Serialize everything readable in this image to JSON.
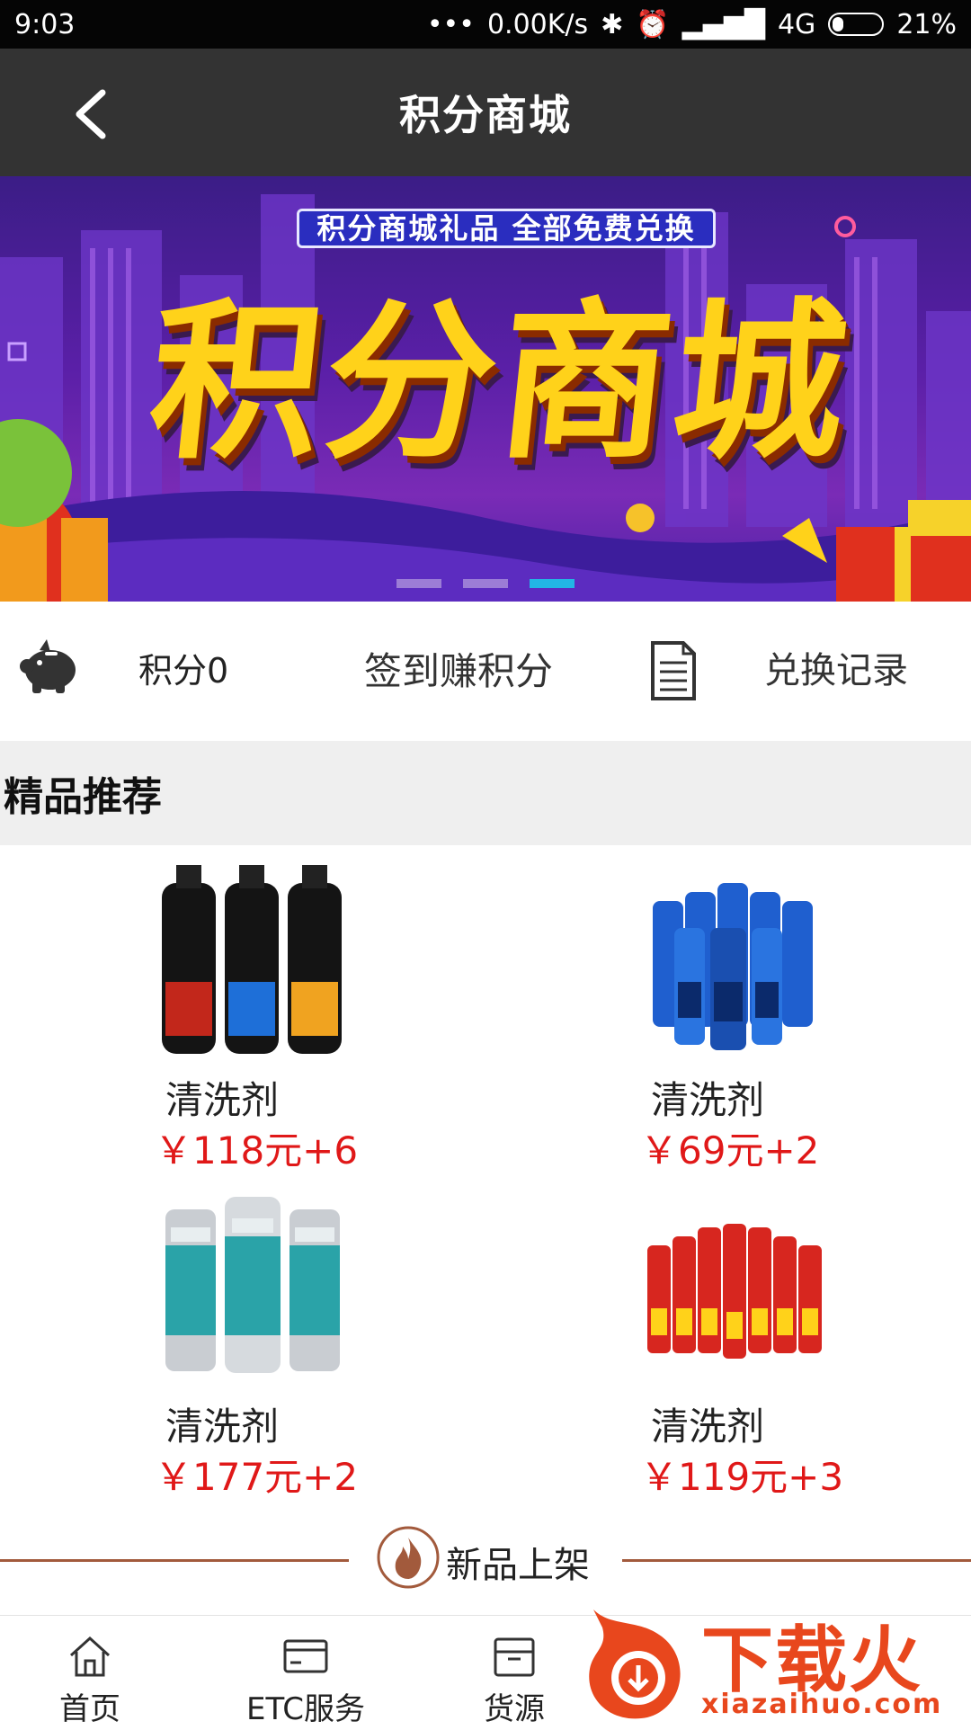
{
  "status_bar": {
    "time": "9:03",
    "speed": "0.00K/s",
    "network": "4G",
    "battery": "21%"
  },
  "nav": {
    "title": "积分商城"
  },
  "banner": {
    "subtitle": "积分商城礼品 全部免费兑换",
    "title": "积分商城",
    "dot_count": 3,
    "active_dot": 3
  },
  "points_row": {
    "points_label": "积分0",
    "signin_label": "签到赚积分",
    "records_label": "兑换记录"
  },
  "section": {
    "title": "精品推荐"
  },
  "products": [
    {
      "name": "清洗剂",
      "price": "￥118元+6",
      "bottle_colors": [
        "#c2271b",
        "#1e6fd8",
        "#f0a320"
      ]
    },
    {
      "name": "清洗剂",
      "price": "￥69元+2",
      "bottle_colors": [
        "#1f5fcf"
      ]
    },
    {
      "name": "清洗剂",
      "price": "￥177元+2",
      "bottle_colors": [
        "#2aa3a8"
      ]
    },
    {
      "name": "清洗剂",
      "price": "￥119元+3",
      "bottle_colors": [
        "#d7261f"
      ]
    }
  ],
  "new_arrivals": {
    "label": "新品上架"
  },
  "tab_bar": {
    "items": [
      {
        "label": "首页",
        "icon": "home-icon"
      },
      {
        "label": "ETC服务",
        "icon": "card-icon"
      },
      {
        "label": "货源",
        "icon": "box-icon"
      }
    ]
  },
  "watermark": {
    "text": "下载火",
    "url": "xiazaihuo.com"
  },
  "colors": {
    "nav_bg": "#333333",
    "price": "#e01818",
    "accent_line": "#a25a3c",
    "active_dot": "#22b6e5"
  }
}
